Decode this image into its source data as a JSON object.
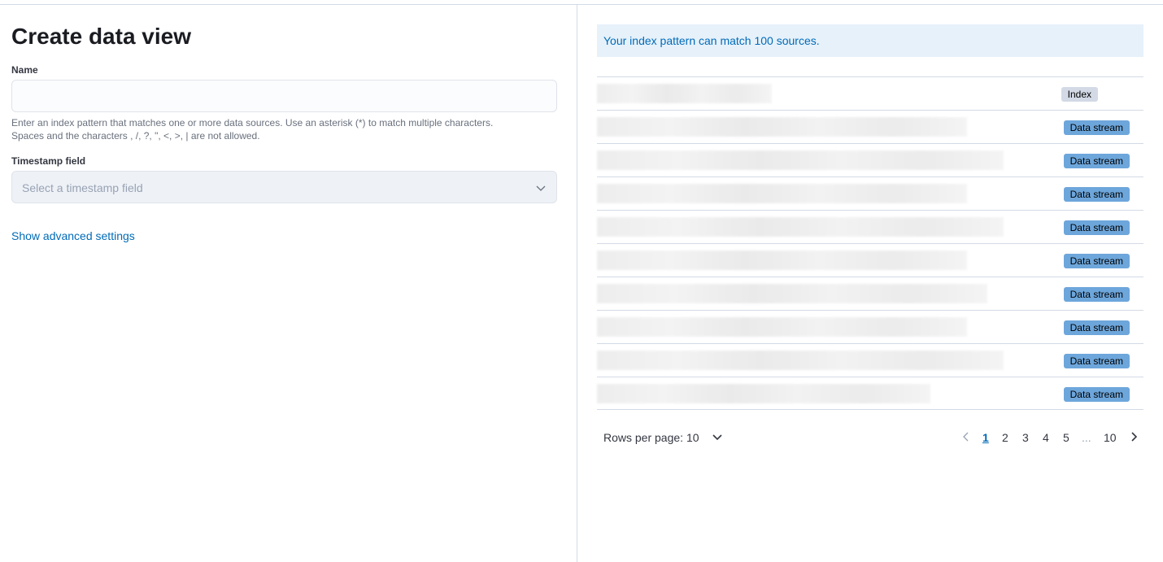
{
  "form": {
    "title": "Create data view",
    "name_label": "Name",
    "name_value": "",
    "help_line1": "Enter an index pattern that matches one or more data sources. Use an asterisk (*) to match multiple characters.",
    "help_line2": "Spaces and the characters , /, ?, \", <, >, | are not allowed.",
    "timestamp_label": "Timestamp field",
    "timestamp_placeholder": "Select a timestamp field",
    "advanced_link": "Show advanced settings"
  },
  "preview": {
    "callout": "Your index pattern can match 100 sources.",
    "rows": [
      {
        "badge": "Index"
      },
      {
        "badge": "Data stream"
      },
      {
        "badge": "Data stream"
      },
      {
        "badge": "Data stream"
      },
      {
        "badge": "Data stream"
      },
      {
        "badge": "Data stream"
      },
      {
        "badge": "Data stream"
      },
      {
        "badge": "Data stream"
      },
      {
        "badge": "Data stream"
      },
      {
        "badge": "Data stream"
      }
    ],
    "pagination": {
      "rows_per_page": "Rows per page: 10",
      "pages": [
        "1",
        "2",
        "3",
        "4",
        "5",
        "...",
        "10"
      ],
      "current_page": "1"
    }
  },
  "colors": {
    "accent": "#006bb8",
    "callout_bg": "#e6f1fa",
    "badge_data_stream": "#6da6db",
    "badge_index": "#d3dae6"
  }
}
